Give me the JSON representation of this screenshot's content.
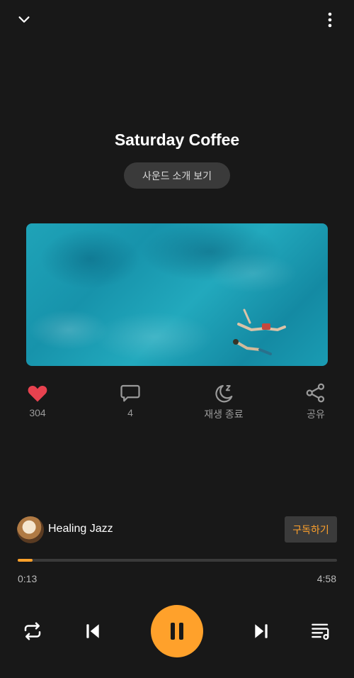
{
  "header": {
    "collapse_icon": "chevron-down-icon",
    "menu_icon": "more-vertical-icon"
  },
  "track": {
    "title": "Saturday Coffee",
    "intro_label": "사운드 소개 보기"
  },
  "actions": {
    "like": {
      "icon": "heart-icon",
      "label": "304",
      "color": "#e8424f"
    },
    "comment": {
      "icon": "comment-icon",
      "label": "4"
    },
    "sleep": {
      "icon": "sleep-moon-icon",
      "label": "재생 종료"
    },
    "share": {
      "icon": "share-icon",
      "label": "공유"
    }
  },
  "channel": {
    "name": "Healing Jazz",
    "subscribe_label": "구독하기"
  },
  "playback": {
    "current": "0:13",
    "total": "4:58",
    "progress": 0.046
  },
  "controls": {
    "repeat_icon": "repeat-icon",
    "prev_icon": "skip-previous-icon",
    "play_icon": "pause-icon",
    "next_icon": "skip-next-icon",
    "playlist_icon": "playlist-icon"
  },
  "colors": {
    "accent": "#ffa12b",
    "background": "#181818"
  }
}
